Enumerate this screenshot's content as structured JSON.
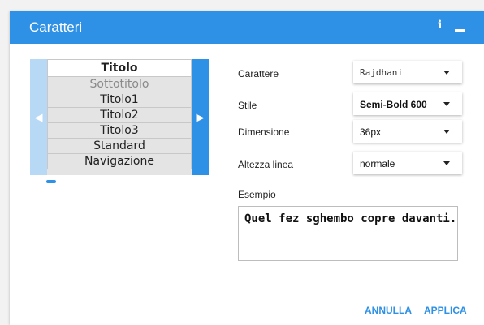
{
  "dialog": {
    "title": "Caratteri",
    "info_glyph": "i"
  },
  "font_list": {
    "items": [
      "Titolo",
      "Sottotitolo",
      "Titolo1",
      "Titolo2",
      "Titolo3",
      "Standard",
      "Navigazione"
    ],
    "selected_index": 0
  },
  "form": {
    "font_label": "Carattere",
    "font_value": "Rajdhani",
    "style_label": "Stile",
    "style_value": "Semi-Bold 600",
    "size_label": "Dimensione",
    "size_value": "36px",
    "line_height_label": "Altezza linea",
    "line_height_value": "normale",
    "sample_label": "Esempio",
    "sample_text": "Quel fez sghembo copre davanti."
  },
  "buttons": {
    "cancel": "ANNULLA",
    "apply": "APPLICA"
  },
  "colors": {
    "accent": "#2e91e6",
    "accent_light": "#b8d9f6"
  }
}
